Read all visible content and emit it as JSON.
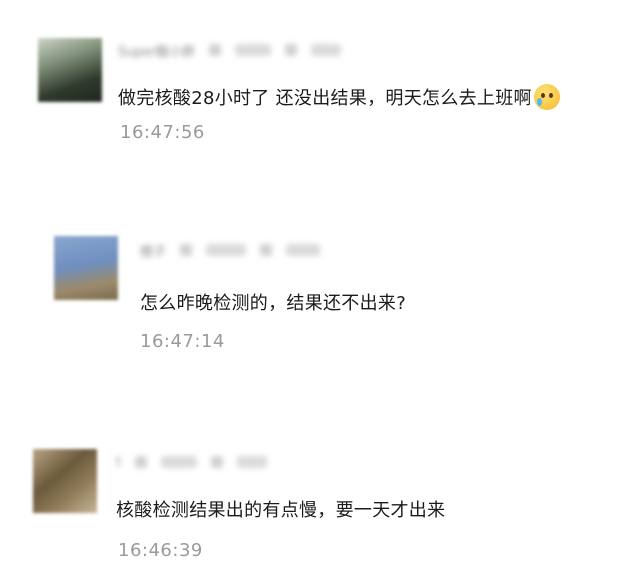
{
  "comments": [
    {
      "nickname": "Super酸小胖",
      "message": "做完核酸28小时了 还没出结果，明天怎么去上班啊",
      "emoji": "crying-face",
      "time": "16:47:56",
      "avatar_colors": [
        "#3d4a3a",
        "#8fa08a"
      ]
    },
    {
      "nickname": "橙子",
      "message": "怎么昨晚检测的，结果还不出来?",
      "time": "16:47:14",
      "avatar_colors": [
        "#6b88b5",
        "#c9a36a"
      ]
    },
    {
      "nickname": "t",
      "message": "核酸检测结果出的有点慢，要一天才出来",
      "time": "16:46:39",
      "avatar_colors": [
        "#6a5a40",
        "#b8a588"
      ]
    }
  ]
}
